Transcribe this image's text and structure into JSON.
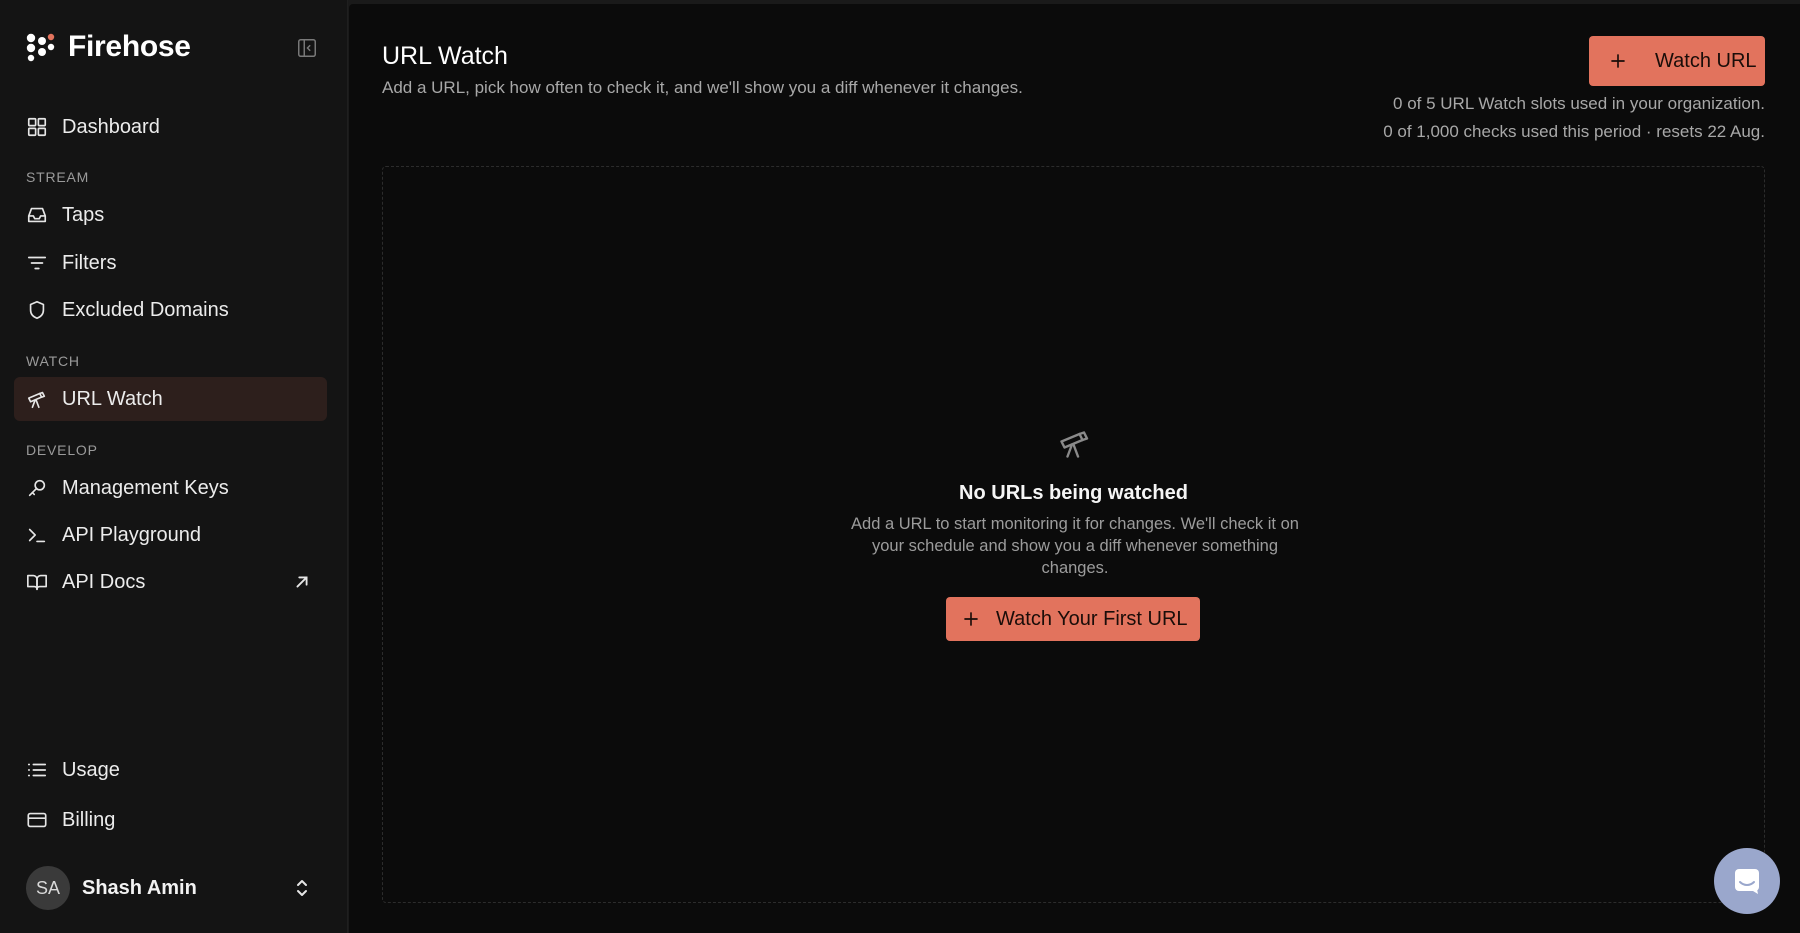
{
  "brand": {
    "name": "Firehose"
  },
  "nav": {
    "dashboard": "Dashboard",
    "stream_label": "STREAM",
    "taps": "Taps",
    "filters": "Filters",
    "excluded_domains": "Excluded Domains",
    "watch_label": "WATCH",
    "url_watch": "URL Watch",
    "develop_label": "DEVELOP",
    "management_keys": "Management Keys",
    "api_playground": "API Playground",
    "api_docs": "API Docs",
    "usage": "Usage",
    "billing": "Billing"
  },
  "user": {
    "initials": "SA",
    "name": "Shash Amin"
  },
  "page": {
    "title": "URL Watch",
    "subtitle": "Add a URL, pick how often to check it, and we'll show you a diff whenever it changes.",
    "watch_button": "Watch URL",
    "slots_usage": "0 of 5 URL Watch slots used in your organization.",
    "checks_usage": "0 of 1,000 checks used this period · resets 22 Aug."
  },
  "empty_state": {
    "title": "No URLs being watched",
    "description": "Add a URL to start monitoring it for changes. We'll check it on your schedule and show you a diff whenever something changes.",
    "button": "Watch Your First URL"
  },
  "colors": {
    "accent": "#e2735d",
    "active_nav_bg": "#2d1f1c",
    "sidebar_bg": "#141414",
    "main_bg": "#0b0b0b"
  },
  "icons": {
    "brand": "firehose-logo",
    "collapse": "sidebar-collapse-icon",
    "dashboard": "grid-icon",
    "taps": "inbox-icon",
    "filters": "filter-lines-icon",
    "excluded_domains": "shield-icon",
    "url_watch": "telescope-icon",
    "management_keys": "key-icon",
    "api_playground": "terminal-icon",
    "api_docs": "book-icon",
    "external": "arrow-up-right-icon",
    "usage": "list-icon",
    "billing": "credit-card-icon",
    "user_switch": "chevrons-up-down-icon",
    "chat": "chat-icon"
  }
}
